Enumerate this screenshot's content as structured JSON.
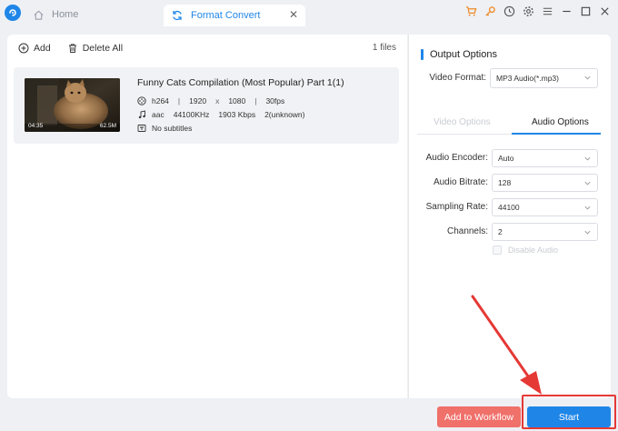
{
  "tabs": {
    "home_label": "Home",
    "active_label": "Format Convert"
  },
  "toolbar": {
    "add_label": "Add",
    "delete_all_label": "Delete All",
    "file_count": "1 files"
  },
  "file": {
    "title": "Funny Cats Compilation (Most Popular) Part 1(1)",
    "duration": "04:35",
    "size": "62.5M",
    "video_codec": "h264",
    "width": "1920",
    "x_sep": "x",
    "height": "1080",
    "fps": "30fps",
    "audio_codec": "aac",
    "sample_rate": "44100KHz",
    "bitrate": "1903 Kbps",
    "channels": "2(unknown)",
    "subtitles": "No subtitles"
  },
  "output": {
    "title": "Output Options",
    "video_format_label": "Video Format:",
    "video_format_value": "MP3 Audio(*.mp3)",
    "tab_video": "Video Options",
    "tab_audio": "Audio Options",
    "encoder_label": "Audio Encoder:",
    "encoder_value": "Auto",
    "bitrate_label": "Audio Bitrate:",
    "bitrate_value": "128",
    "sampling_label": "Sampling Rate:",
    "sampling_value": "44100",
    "channels_label": "Channels:",
    "channels_value": "2",
    "disable_audio_label": "Disable Audio"
  },
  "actions": {
    "workflow_label": "Add to Workflow",
    "start_label": "Start"
  },
  "colors": {
    "accent": "#1f86e8",
    "workflow": "#f0706a",
    "highlight": "#e53935"
  }
}
